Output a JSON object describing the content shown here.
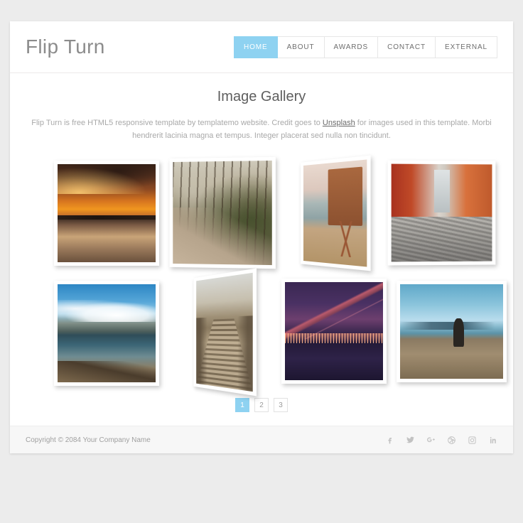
{
  "brand": {
    "name": "Flip Turn"
  },
  "nav": {
    "items": [
      {
        "label": "HOME",
        "active": true
      },
      {
        "label": "ABOUT",
        "active": false
      },
      {
        "label": "AWARDS",
        "active": false
      },
      {
        "label": "CONTACT",
        "active": false
      },
      {
        "label": "EXTERNAL",
        "active": false
      }
    ]
  },
  "main": {
    "title": "Image Gallery",
    "intro_before": "Flip Turn is free HTML5 responsive template by templatemo website. Credit goes to ",
    "intro_link": "Unsplash",
    "intro_after": " for images used in this template. Morbi hendrerit lacinia magna et tempus. Integer placerat sed nulla non tincidunt."
  },
  "gallery": {
    "items": [
      {
        "id": "shot1",
        "alt": "Sunset over a beach with tidal pools"
      },
      {
        "id": "shot2",
        "alt": "Winding dirt road through a bare forest"
      },
      {
        "id": "shot3",
        "alt": "Wooden lifeguard tower on the sand"
      },
      {
        "id": "shot4",
        "alt": "Narrow cobblestone alley with orange buildings"
      },
      {
        "id": "shot5",
        "alt": "Snowy mountains reflected in a calm lake"
      },
      {
        "id": "shot6",
        "alt": "Wooden boardwalk leading into the distance"
      },
      {
        "id": "shot7",
        "alt": "Suspension bridge and city skyline at night"
      },
      {
        "id": "shot8",
        "alt": "Person and bicycle silhouetted at the waterfront"
      }
    ]
  },
  "pagination": {
    "pages": [
      {
        "label": "1",
        "active": true
      },
      {
        "label": "2",
        "active": false
      },
      {
        "label": "3",
        "active": false
      }
    ]
  },
  "footer": {
    "copyright": "Copyright © 2084 Your Company Name",
    "socials": [
      {
        "name": "facebook-icon"
      },
      {
        "name": "twitter-icon"
      },
      {
        "name": "google-plus-icon"
      },
      {
        "name": "dribbble-icon"
      },
      {
        "name": "instagram-icon"
      },
      {
        "name": "linkedin-icon"
      }
    ]
  },
  "colors": {
    "accent": "#8ed2f1",
    "page_background": "#ececec",
    "container_background": "#ffffff",
    "footer_background": "#f7f7f7",
    "text_muted": "#a9a9a9"
  }
}
